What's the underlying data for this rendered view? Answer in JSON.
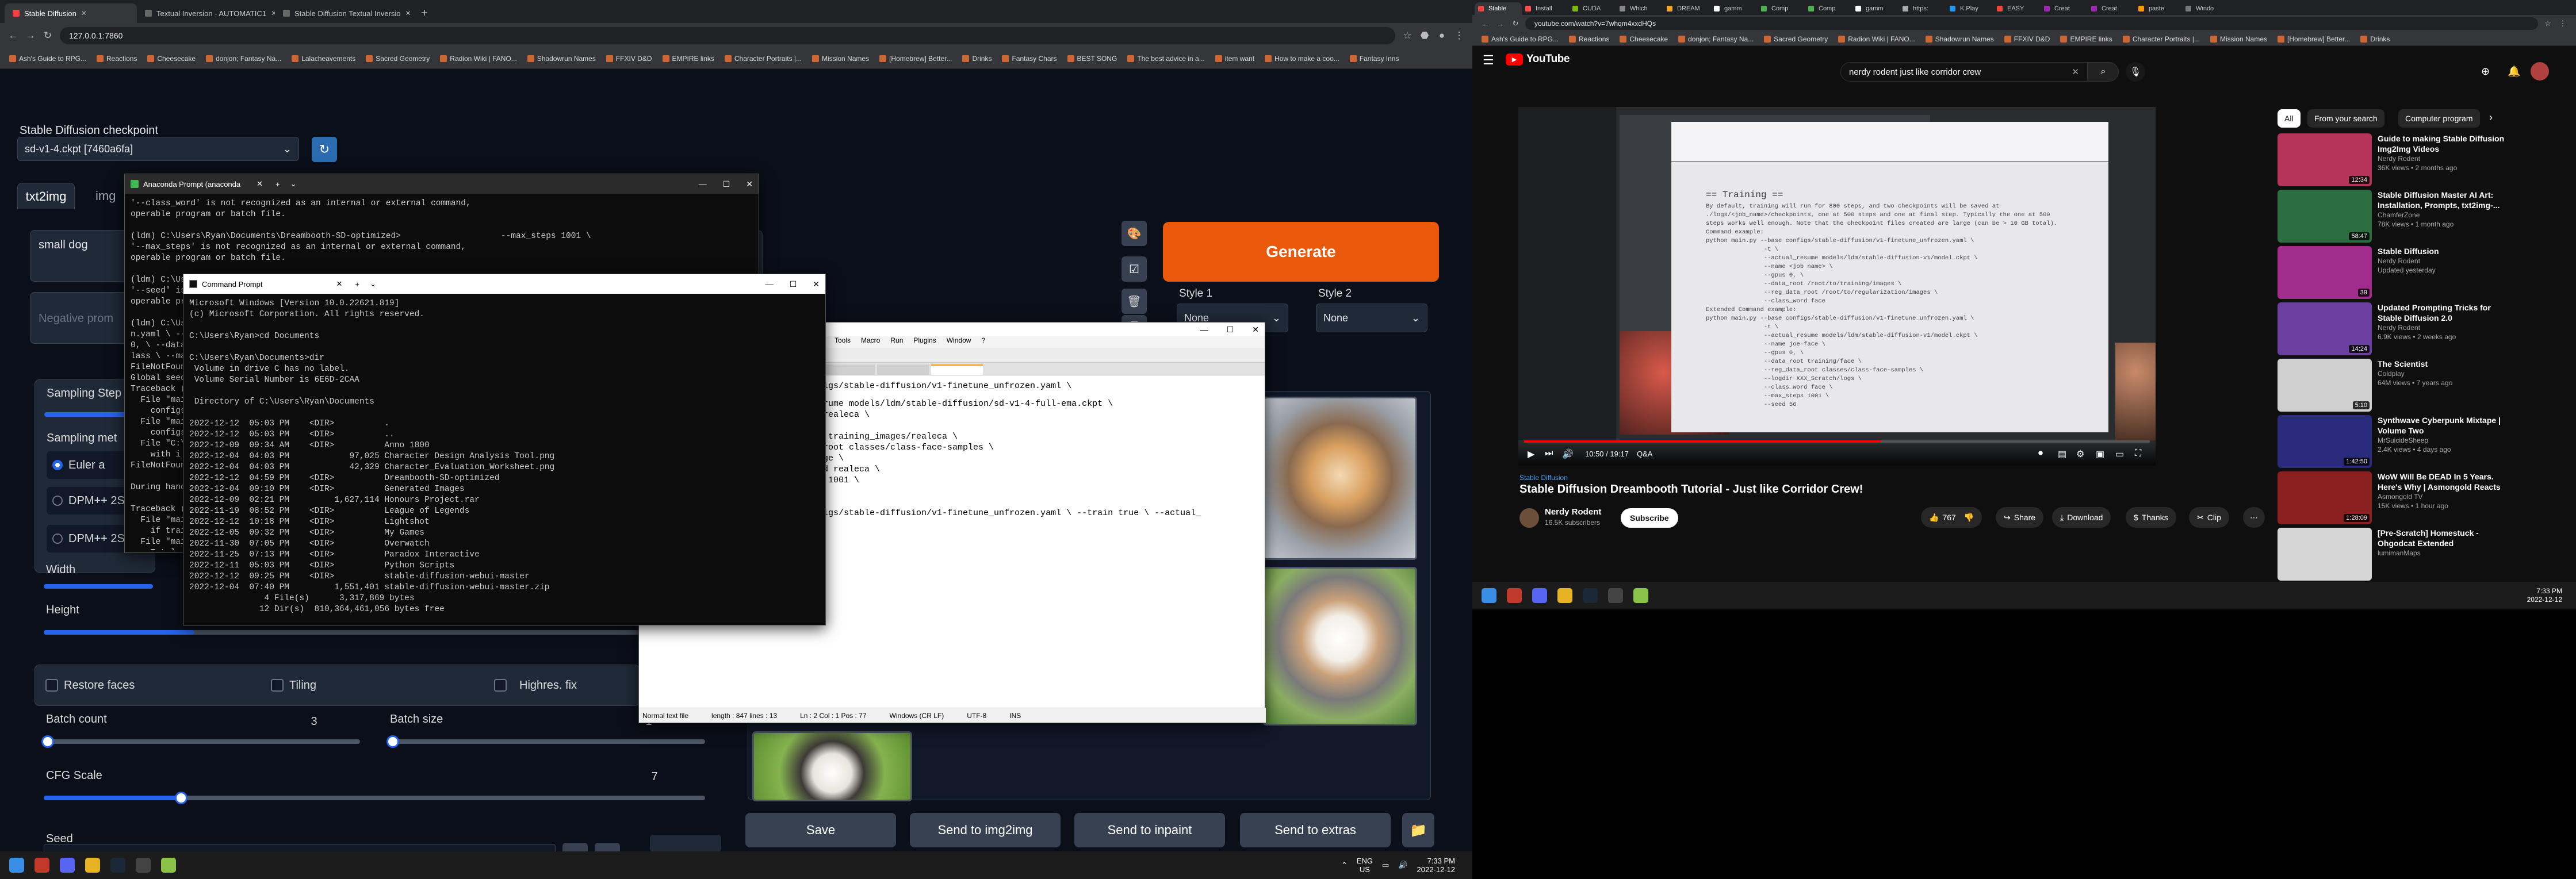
{
  "left_browser": {
    "tabs": [
      {
        "label": "Stable Diffusion",
        "active": true
      },
      {
        "label": "Textual Inversion - AUTOMATIC1",
        "active": false
      },
      {
        "label": "Stable Diffusion Textual Inversio",
        "active": false
      }
    ],
    "url": "127.0.0.1:7860",
    "bookmarks": [
      "Ash's Guide to RPG...",
      "Reactions",
      "Cheesecake",
      "donjon; Fantasy Na...",
      "Lalacheavements",
      "Sacred Geometry",
      "Radion Wiki | FANO...",
      "Shadowrun Names",
      "FFXIV D&D",
      "EMPIRE links",
      "Character Portraits |...",
      "Mission Names",
      "[Homebrew] Better...",
      "Drinks",
      "Fantasy Chars",
      "BEST SONG",
      "The best advice in a...",
      "item want",
      "How to make a coo...",
      "Fantasy Inns"
    ]
  },
  "sd": {
    "checkpoint_label": "Stable Diffusion checkpoint",
    "checkpoint_value": "sd-v1-4.ckpt [7460a6fa]",
    "tab_txt2img": "txt2img",
    "tab_img": "img",
    "prompt": "small dog",
    "negative_placeholder": "Negative prom",
    "generate": "Generate",
    "style1_label": "Style 1",
    "style2_label": "Style 2",
    "style1_value": "None",
    "style2_value": "None",
    "sampling_steps": "Sampling Step",
    "sampling_method": "Sampling met",
    "method_euler": "Euler a",
    "method_dpm1": "DPM++ 2S",
    "method_dpm2": "DPM++ 2S",
    "width": "Width",
    "height": "Height",
    "restore_faces": "Restore faces",
    "tiling": "Tiling",
    "highres": "Highres. fix",
    "batch_count_label": "Batch count",
    "batch_count": "3",
    "batch_size_label": "Batch size",
    "batch_size": "1",
    "cfg_label": "CFG Scale",
    "cfg_value": "7",
    "seed_label": "Seed",
    "save": "Save",
    "send_img2img": "Send to img2img",
    "send_inpaint": "Send to inpaint",
    "send_extras": "Send to extras"
  },
  "anaconda": {
    "title": "Anaconda Prompt (anaconda",
    "lines": [
      "'--class_word' is not recognized as an internal or external command,",
      "operable program or batch file.",
      "",
      "(ldm) C:\\Users\\Ryan\\Documents\\Dreambooth-SD-optimized>                    --max_steps 1001 \\",
      "'--max_steps' is not recognized as an internal or external command,",
      "operable program or batch file.",
      "",
      "(ldm) C:\\Use",
      "'--seed' is",
      "operable pro",
      "",
      "(ldm) C:\\Use",
      "n.yaml \\ --t",
      "0, \\ --data",
      "lass \\ --ma",
      "FileNotFound",
      "Global seed",
      "Traceback (m",
      "  File \"mai",
      "    configs",
      "  File \"mai",
      "    configs",
      "  File \"C:\\",
      "    with i",
      "FileNotFound",
      "",
      "During handl",
      "",
      "Traceback (m",
      "  File \"mai",
      "    if trai",
      "  File \"mai",
      "    Total"
    ]
  },
  "cmd": {
    "title": "Command Prompt",
    "lines": [
      "Microsoft Windows [Version 10.0.22621.819]",
      "(c) Microsoft Corporation. All rights reserved.",
      "",
      "C:\\Users\\Ryan>cd Documents",
      "",
      "C:\\Users\\Ryan\\Documents>dir",
      " Volume in drive C has no label.",
      " Volume Serial Number is 6E6D-2CAA",
      "",
      " Directory of C:\\Users\\Ryan\\Documents",
      "",
      "2022-12-12  05:03 PM    <DIR>          .",
      "2022-12-12  05:03 PM    <DIR>          ..",
      "2022-12-09  09:34 AM    <DIR>          Anno 1800",
      "2022-12-04  04:03 PM            97,025 Character Design Analysis Tool.png",
      "2022-12-04  04:03 PM            42,329 Character_Evaluation_Worksheet.png",
      "2022-12-12  04:59 PM    <DIR>          Dreambooth-SD-optimized",
      "2022-12-04  09:10 PM    <DIR>          Generated Images",
      "2022-12-09  02:21 PM         1,627,114 Honours Project.rar",
      "2022-11-19  08:52 PM    <DIR>          League of Legends",
      "2022-12-12  10:18 PM    <DIR>          Lightshot",
      "2022-12-05  09:32 PM    <DIR>          My Games",
      "2022-11-30  07:05 PM    <DIR>          Overwatch",
      "2022-11-25  07:13 PM    <DIR>          Paradox Interactive",
      "2022-12-11  05:03 PM    <DIR>          Python Scripts",
      "2022-12-12  09:25 PM    <DIR>          stable-diffusion-webui-master",
      "2022-12-04  07:40 PM         1,551,401 stable-diffusion-webui-master.zip",
      "               4 File(s)      3,317,869 bytes",
      "              12 Dir(s)  810,364,461,056 bytes free"
    ]
  },
  "editor": {
    "menus": [
      "Tools",
      "Macro",
      "Run",
      "Plugins",
      "Window",
      "?"
    ],
    "lines": [
      "rume models/ldm/stable-diffusion/sd-v1-4-full-ema.ckpt \\",
      "realeca \\",
      "",
      " training_images/realeca \\",
      "root classes/class-face-samples \\",
      "ge \\",
      "d realeca \\",
      " 1001 \\",
      "",
      "",
      "igs/stable-diffusion/v1-finetune_unfrozen.yaml \\ --train true \\ --actual_"
    ],
    "top_line": "igs/stable-diffusion/v1-finetune_unfrozen.yaml \\",
    "status": [
      "Normal text file",
      "length : 847   lines : 13",
      "Ln : 2   Col : 1   Pos : 77",
      "Windows (CR LF)",
      "UTF-8",
      "INS"
    ]
  },
  "taskbar_left": {
    "lang": "ENG",
    "region": "US",
    "time": "7:33 PM",
    "date": "2022-12-12"
  },
  "youtube": {
    "tabs": [
      "Stable",
      "Install",
      "CUDA",
      "Which",
      "DREAM",
      "gamm",
      "Comp",
      "Comp",
      "gamm",
      "https:",
      "K.Play",
      "EASY",
      "Creat",
      "Creat",
      "paste",
      "Windo"
    ],
    "url": "youtube.com/watch?v=7whqm4xxdHQs",
    "bookmarks": [
      "Ash's Guide to RPG...",
      "Reactions",
      "Cheesecake",
      "donjon; Fantasy Na...",
      "Sacred Geometry",
      "Radion Wiki | FANO...",
      "Shadowrun Names",
      "FFXIV D&D",
      "EMPIRE links",
      "Character Portraits |...",
      "Mission Names",
      "[Homebrew] Better...",
      "Drinks"
    ],
    "search": "nerdy rodent just like corridor crew",
    "logo": "YouTube",
    "chips": [
      "All",
      "From your search",
      "Computer program"
    ],
    "video_tag": "Stable Diffusion",
    "video_title": "Stable Diffusion Dreambooth Tutorial - Just like Corridor Crew!",
    "channel": "Nerdy Rodent",
    "subs": "16.5K subscribers",
    "subscribe": "Subscribe",
    "likes": "767",
    "share": "Share",
    "download": "Download",
    "thanks": "Thanks",
    "clip": "Clip",
    "player_time": "10:50 / 19:17",
    "player_chapter": "Q&A",
    "slide_heading": "== Training ==",
    "slide_lines": [
      "By default, training will run for 800 steps, and two checkpoints will be saved at",
      "./logs/<job_name>/checkpoints, one at 500 steps and one at final step. Typically the one at 500",
      "steps works well enough. Note that the checkpoint files created are large (can be > 10 GB total).",
      "Command example:",
      "python main.py --base configs/stable-diffusion/v1-finetune_unfrozen.yaml \\",
      "                -t \\",
      "                --actual_resume models/ldm/stable-diffusion-v1/model.ckpt \\",
      "                --name <job name> \\",
      "                --gpus 0, \\",
      "                --data_root /root/to/training/images \\",
      "                --reg_data_root /root/to/regularization/images \\",
      "                --class_word face",
      "Extended Command example:",
      "python main.py --base configs/stable-diffusion/v1-finetune_unfrozen.yaml \\",
      "                -t \\",
      "                --actual_resume models/ldm/stable-diffusion-v1/model.ckpt \\",
      "                --name joe-face \\",
      "                --gpus 0, \\",
      "                --data_root training/face \\",
      "                --reg_data_root classes/class-face-samples \\",
      "                --logdir XXX_Scratch/logs \\",
      "                --class_word face \\",
      "                --max_steps 1001 \\",
      "                --seed 56"
    ],
    "recs": [
      {
        "title": "Guide to making Stable Diffusion Img2Img Videos",
        "channel": "Nerdy Rodent",
        "meta": "36K views • 2 months ago",
        "dur": "12:34",
        "color": "#b5345a"
      },
      {
        "title": "Stable Diffusion Master AI Art: Installation, Prompts, txt2img-...",
        "channel": "ChamferZone",
        "meta": "78K views • 1 month ago",
        "dur": "58:47",
        "color": "#2c6e3f"
      },
      {
        "title": "Stable Diffusion",
        "channel": "Nerdy Rodent",
        "meta": "Updated yesterday",
        "dur": "39",
        "color": "#a22c8c"
      },
      {
        "title": "Updated Prompting Tricks for Stable Diffusion 2.0",
        "channel": "Nerdy Rodent",
        "meta": "6.9K views • 2 weeks ago",
        "dur": "14:24",
        "color": "#6b3fa0"
      },
      {
        "title": "The Scientist",
        "channel": "Coldplay",
        "meta": "64M views • 7 years ago",
        "dur": "5:10",
        "color": "#cfcfcf"
      },
      {
        "title": "Synthwave Cyberpunk Mixtape | Volume Two",
        "channel": "MrSuicideSheep",
        "meta": "2.4K views • 4 days ago",
        "dur": "1:42:50",
        "color": "#2a2a7a"
      },
      {
        "title": "WoW Will Be DEAD In 5 Years. Here's Why | Asmongold Reacts",
        "channel": "Asmongold TV",
        "meta": "15K views • 1 hour ago",
        "dur": "1:28:09",
        "color": "#8a1f1f"
      },
      {
        "title": "[Pre-Scratch] Homestuck - Ohgodcat Extended",
        "channel": "lumimanMaps",
        "meta": "",
        "dur": "",
        "color": "#d6d6d6"
      }
    ]
  },
  "taskbar_right": {
    "time": "7:33 PM",
    "date": "2022-12-12"
  },
  "colors": {
    "generate_orange": "#ea580c",
    "slider_blue": "#2563eb",
    "yt_red": "#ff0000"
  }
}
